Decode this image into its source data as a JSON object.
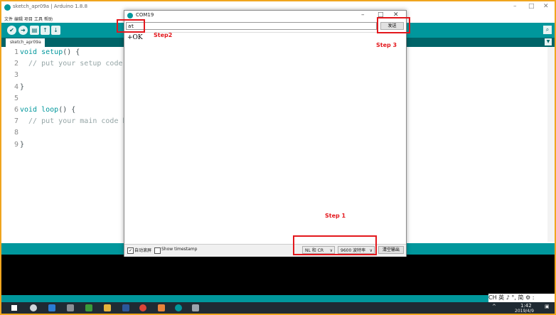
{
  "ide": {
    "title": "sketch_apr09a | Arduino 1.8.8",
    "menu": [
      "文件",
      "编辑",
      "项目",
      "工具",
      "帮助"
    ],
    "tab_label": "sketch_apr09a",
    "code_lines": [
      {
        "num": "1",
        "parts": [
          {
            "t": "void",
            "c": "kw"
          },
          {
            "t": " "
          },
          {
            "t": "setup",
            "c": "kw"
          },
          {
            "t": "() {"
          }
        ]
      },
      {
        "num": "2",
        "parts": [
          {
            "t": "  // put your setup code h",
            "c": "cm"
          }
        ]
      },
      {
        "num": "3",
        "parts": []
      },
      {
        "num": "4",
        "parts": [
          {
            "t": "}"
          }
        ]
      },
      {
        "num": "5",
        "parts": []
      },
      {
        "num": "6",
        "parts": [
          {
            "t": "void",
            "c": "kw"
          },
          {
            "t": " "
          },
          {
            "t": "loop",
            "c": "kw"
          },
          {
            "t": "() {"
          }
        ]
      },
      {
        "num": "7",
        "parts": [
          {
            "t": "  // put your main code he",
            "c": "cm"
          }
        ]
      },
      {
        "num": "8",
        "parts": []
      },
      {
        "num": "9",
        "parts": [
          {
            "t": "}"
          }
        ]
      }
    ]
  },
  "serial_monitor": {
    "title": "COM19",
    "input_value": "at",
    "send_label": "发送",
    "output_lines": [
      "+OK"
    ],
    "autoscroll_label": "自动滚屏",
    "timestamp_label": "Show timestamp",
    "autoscroll_checked": true,
    "timestamp_checked": false,
    "line_ending": "NL 和 CR",
    "baud_rate": "9600 波特率",
    "clear_label": "清空输出"
  },
  "annotations": {
    "step1": "Step 1",
    "step2": "Step2",
    "step3": "Step 3",
    "color": "#e3181d"
  },
  "taskbar": {
    "time": "1:42",
    "date": "2019/4/9",
    "ime": "CH",
    "ime_extra": "英 ♪ °, 简 ⚙ :"
  }
}
